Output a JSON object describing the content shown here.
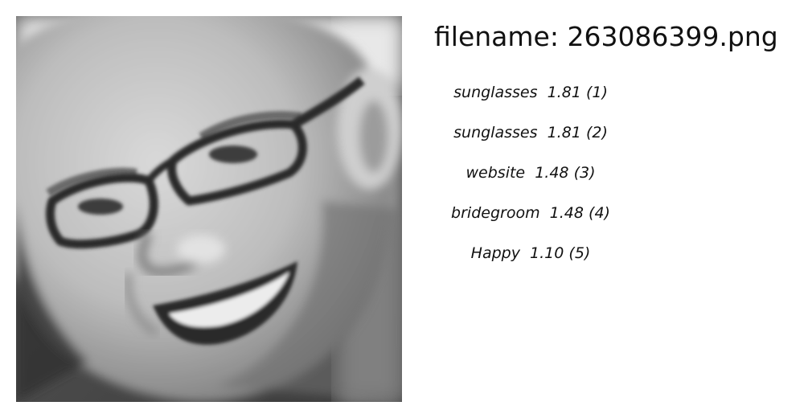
{
  "image": {
    "description_icon": "face-photo"
  },
  "filename": {
    "prefix": "filename: ",
    "value": "263086399.png"
  },
  "tags": [
    {
      "label": "sunglasses",
      "score": "1.81",
      "rank": "(1)"
    },
    {
      "label": "sunglasses",
      "score": "1.81",
      "rank": "(2)"
    },
    {
      "label": "website",
      "score": "1.48",
      "rank": "(3)"
    },
    {
      "label": "bridegroom",
      "score": "1.48",
      "rank": "(4)"
    },
    {
      "label": "Happy",
      "score": "1.10",
      "rank": "(5)"
    }
  ]
}
